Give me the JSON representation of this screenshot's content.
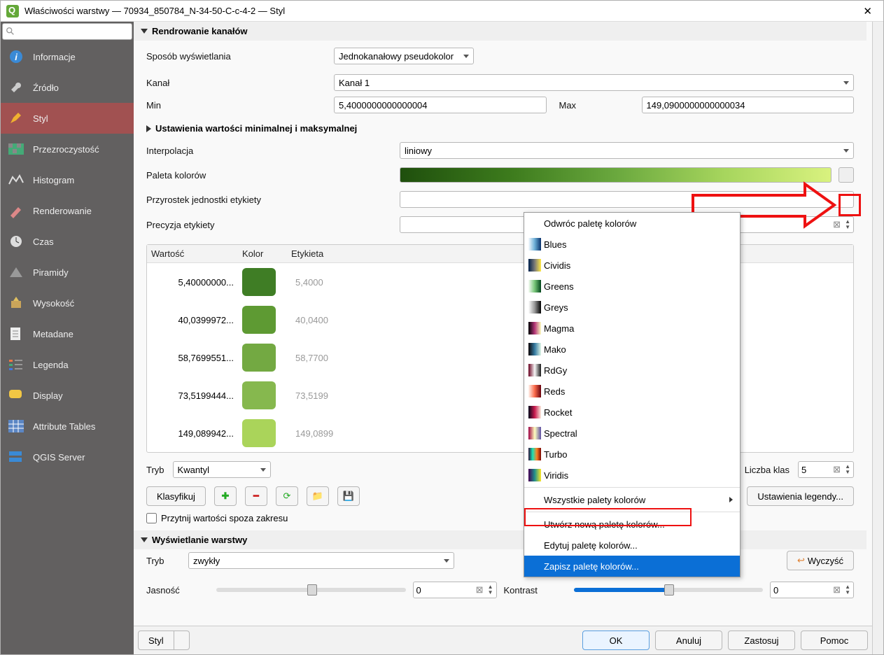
{
  "window": {
    "title": "Właściwości warstwy — 70934_850784_N-34-50-C-c-4-2 — Styl"
  },
  "sidebar": {
    "items": [
      {
        "label": "Informacje"
      },
      {
        "label": "Źródło"
      },
      {
        "label": "Styl"
      },
      {
        "label": "Przezroczystość"
      },
      {
        "label": "Histogram"
      },
      {
        "label": "Renderowanie"
      },
      {
        "label": "Czas"
      },
      {
        "label": "Piramidy"
      },
      {
        "label": "Wysokość"
      },
      {
        "label": "Metadane"
      },
      {
        "label": "Legenda"
      },
      {
        "label": "Display"
      },
      {
        "label": "Attribute Tables"
      },
      {
        "label": "QGIS Server"
      }
    ]
  },
  "sections": {
    "render_channels": "Rendrowanie kanałów",
    "minmax": "Ustawienia wartości minimalnej i maksymalnej",
    "layerdisplay": "Wyświetlanie warstwy"
  },
  "form": {
    "render_mode_label": "Sposób wyświetlania",
    "render_mode_value": "Jednokanałowy pseudokolor",
    "channel_label": "Kanał",
    "channel_value": "Kanał 1",
    "min_label": "Min",
    "min_value": "5,4000000000000004",
    "max_label": "Max",
    "max_value": "149,0900000000000034",
    "interp_label": "Interpolacja",
    "interp_value": "liniowy",
    "palette_label": "Paleta kolorów",
    "unit_suffix_label": "Przyrostek jednostki etykiety",
    "precision_label": "Precyzja etykiety",
    "mode_label": "Tryb",
    "mode_value": "Kwantyl",
    "classes_label": "Liczba klas",
    "classes_value": "5",
    "classify": "Klasyfikuj",
    "legend_settings": "Ustawienia legendy...",
    "clip_label": "Przytnij wartości spoza zakresu",
    "blend_label": "Tryb",
    "blend_value": "zwykły",
    "reset": "Wyczyść",
    "brightness_label": "Jasność",
    "brightness_value": "0",
    "contrast_label": "Kontrast",
    "contrast_value": "0",
    "style_btn": "Styl"
  },
  "table": {
    "headers": {
      "value": "Wartość",
      "color": "Kolor",
      "label": "Etykieta"
    },
    "rows": [
      {
        "value": "5,40000000...",
        "color": "#3f7d25",
        "label": "5,4000"
      },
      {
        "value": "40,0399972...",
        "color": "#5e9a33",
        "label": "40,0400"
      },
      {
        "value": "58,7699551...",
        "color": "#73a942",
        "label": "58,7700"
      },
      {
        "value": "73,5199444...",
        "color": "#86b84e",
        "label": "73,5199"
      },
      {
        "value": "149,089942...",
        "color": "#aad45a",
        "label": "149,0899"
      }
    ]
  },
  "menu": {
    "invert": "Odwróc paletę kolorów",
    "palettes": [
      {
        "name": "Blues",
        "grad": "linear-gradient(to right,#f7fbff,#6baed6,#08306b)"
      },
      {
        "name": "Cividis",
        "grad": "linear-gradient(to right,#00204c,#7b7b78,#ffe945)"
      },
      {
        "name": "Greens",
        "grad": "linear-gradient(to right,#f7fcf5,#74c476,#00441b)"
      },
      {
        "name": "Greys",
        "grad": "linear-gradient(to right,#ffffff,#969696,#000000)"
      },
      {
        "name": "Magma",
        "grad": "linear-gradient(to right,#000004,#b63679,#fcfdbf)"
      },
      {
        "name": "Mako",
        "grad": "linear-gradient(to right,#0b0405,#357ba3,#def5e5)"
      },
      {
        "name": "RdGy",
        "grad": "linear-gradient(to right,#67001f,#f7f7f7,#1a1a1a)"
      },
      {
        "name": "Reds",
        "grad": "linear-gradient(to right,#fff5f0,#fb6a4a,#67000d)"
      },
      {
        "name": "Rocket",
        "grad": "linear-gradient(to right,#03051a,#cb1b4f,#faebdd)"
      },
      {
        "name": "Spectral",
        "grad": "linear-gradient(to right,#9e0142,#ffffbf,#5e4fa2)"
      },
      {
        "name": "Turbo",
        "grad": "linear-gradient(to right,#30123b,#1ae4b6,#fb8022,#7a0403)"
      },
      {
        "name": "Viridis",
        "grad": "linear-gradient(to right,#440154,#21918c,#fde725)"
      }
    ],
    "all": "Wszystkie palety kolorów",
    "create": "Utwórz nową paletę kolorów...",
    "edit": "Edytuj paletę kolorów...",
    "save": "Zapisz paletę kolorów..."
  },
  "footer": {
    "ok": "OK",
    "cancel": "Anuluj",
    "apply": "Zastosuj",
    "help": "Pomoc"
  }
}
